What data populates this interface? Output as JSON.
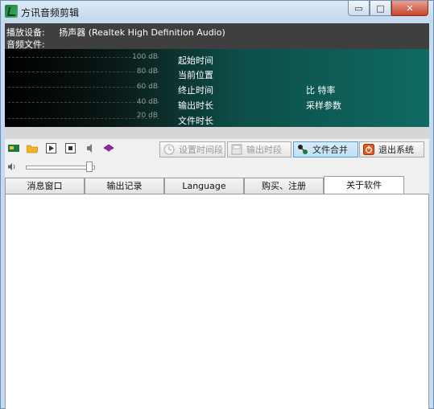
{
  "window": {
    "title": "方讯音频剪辑",
    "buttons": {
      "minimize": "▭",
      "maximize": "□",
      "close": "✕"
    }
  },
  "info": {
    "device_label": "播放设备:",
    "device_value": "扬声器 (Realtek High Definition Audio)",
    "file_label": "音频文件:"
  },
  "meter": {
    "db_levels": [
      "100 dB",
      "80 dB",
      "60 dB",
      "40 dB",
      "20 dB"
    ],
    "labels": [
      "起始时间",
      "当前位置",
      "终止时间",
      "输出时长",
      "文件时长"
    ],
    "right_labels": [
      "比 特率",
      "采样参数"
    ]
  },
  "toolbar": {
    "icons": [
      "card-icon",
      "folder-icon",
      "play-icon",
      "stop-icon",
      "speaker-small-icon",
      "book-icon"
    ],
    "buttons": [
      {
        "label": "设置时间段",
        "enabled": false
      },
      {
        "label": "输出时段",
        "enabled": false
      },
      {
        "label": "文件合并",
        "enabled": true
      },
      {
        "label": "退出系统",
        "enabled": true
      }
    ],
    "volume_level": 0.92
  },
  "tabs": [
    {
      "label": "消息窗口",
      "active": false
    },
    {
      "label": "输出记录",
      "active": false
    },
    {
      "label": "Language",
      "active": false
    },
    {
      "label": "购买、注册",
      "active": false
    },
    {
      "label": "关于软件",
      "active": true
    }
  ]
}
